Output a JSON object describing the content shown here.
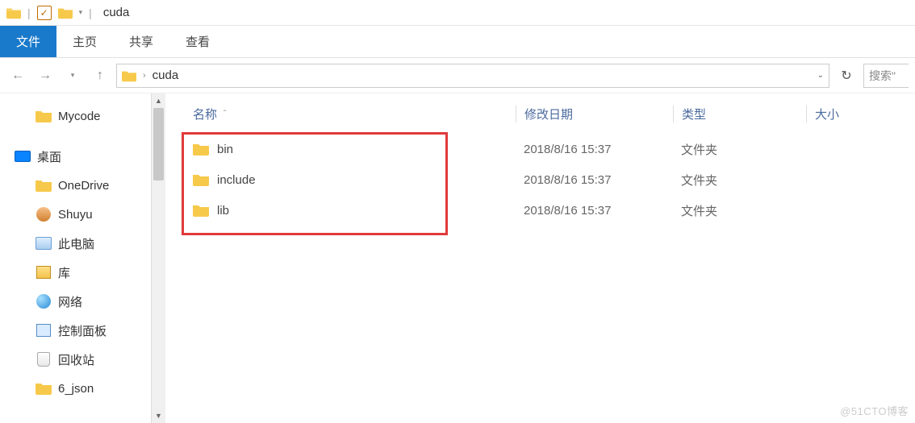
{
  "title": "cuda",
  "ribbon": {
    "file": "文件",
    "home": "主页",
    "share": "共享",
    "view": "查看"
  },
  "breadcrumb": {
    "current": "cuda"
  },
  "search": {
    "placeholder": "搜索\""
  },
  "sidebar": {
    "items": [
      {
        "label": "Mycode",
        "icon": "folder"
      },
      {
        "label": "桌面",
        "icon": "desktop"
      },
      {
        "label": "OneDrive",
        "icon": "folder"
      },
      {
        "label": "Shuyu",
        "icon": "user"
      },
      {
        "label": "此电脑",
        "icon": "pc"
      },
      {
        "label": "库",
        "icon": "lib"
      },
      {
        "label": "网络",
        "icon": "net"
      },
      {
        "label": "控制面板",
        "icon": "panel"
      },
      {
        "label": "回收站",
        "icon": "recycle"
      },
      {
        "label": "6_json",
        "icon": "folder"
      }
    ]
  },
  "columns": {
    "name": "名称",
    "date": "修改日期",
    "type": "类型",
    "size": "大小"
  },
  "rows": [
    {
      "name": "bin",
      "date": "2018/8/16 15:37",
      "type": "文件夹"
    },
    {
      "name": "include",
      "date": "2018/8/16 15:37",
      "type": "文件夹"
    },
    {
      "name": "lib",
      "date": "2018/8/16 15:37",
      "type": "文件夹"
    }
  ],
  "watermark": "@51CTO博客"
}
